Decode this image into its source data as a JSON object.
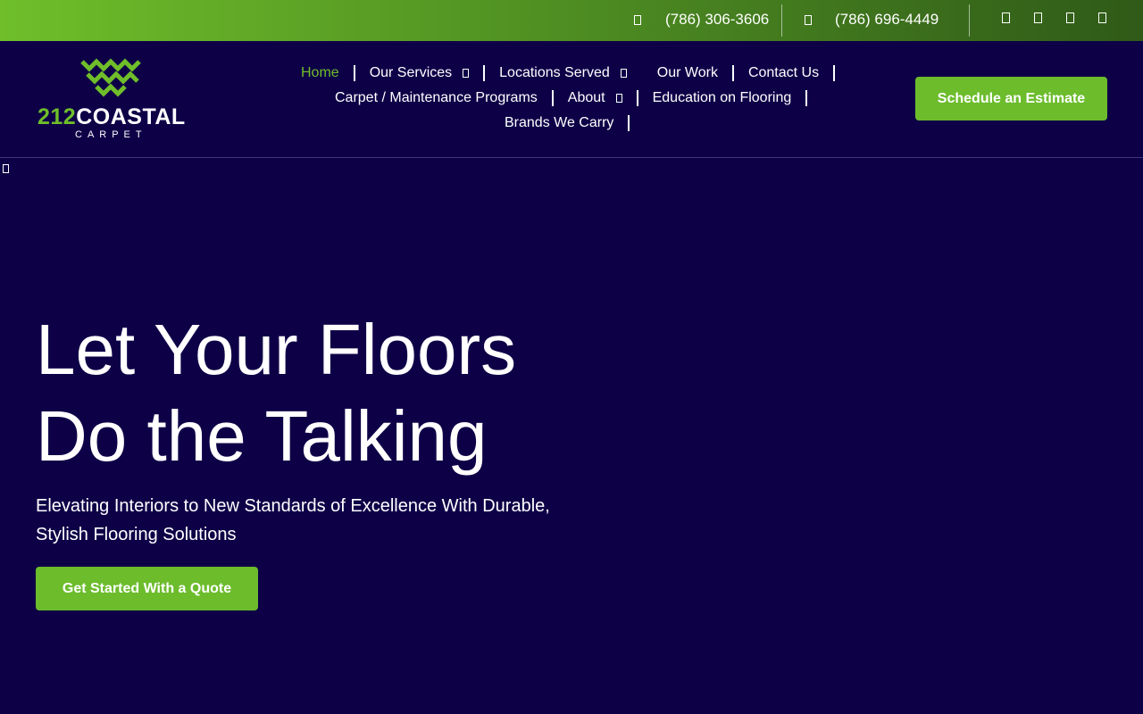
{
  "topbar": {
    "phones": [
      {
        "icon": "phone-icon",
        "number": "(786) 306-3606"
      },
      {
        "icon": "phone-icon",
        "number": "(786) 696-4449"
      }
    ],
    "social_icons": [
      "facebook-icon",
      "instagram-icon",
      "linkedin-icon",
      "youtube-icon"
    ]
  },
  "logo": {
    "number": "212",
    "name": "COASTAL",
    "sub": "CARPET"
  },
  "nav": {
    "items": [
      {
        "label": "Home",
        "active": true
      },
      {
        "label": "Our Services",
        "dropdown": true
      },
      {
        "label": "Locations Served",
        "dropdown": true
      },
      {
        "label": "Our Work"
      },
      {
        "label": "Contact Us"
      },
      {
        "label": "Carpet / Maintenance Programs"
      },
      {
        "label": "About",
        "dropdown": true
      },
      {
        "label": "Education on Flooring"
      },
      {
        "label": "Brands We Carry"
      }
    ]
  },
  "header": {
    "cta_label": "Schedule an Estimate"
  },
  "hero": {
    "title_line1": "Let Your Floors",
    "title_line2": "Do the Talking",
    "subtitle": "Elevating Interiors to New Standards of Excellence With Durable, Stylish Flooring Solutions",
    "cta_label": "Get Started With a Quote"
  },
  "colors": {
    "brand_green": "#6cbc2c",
    "navy_background": "#0e0047"
  }
}
